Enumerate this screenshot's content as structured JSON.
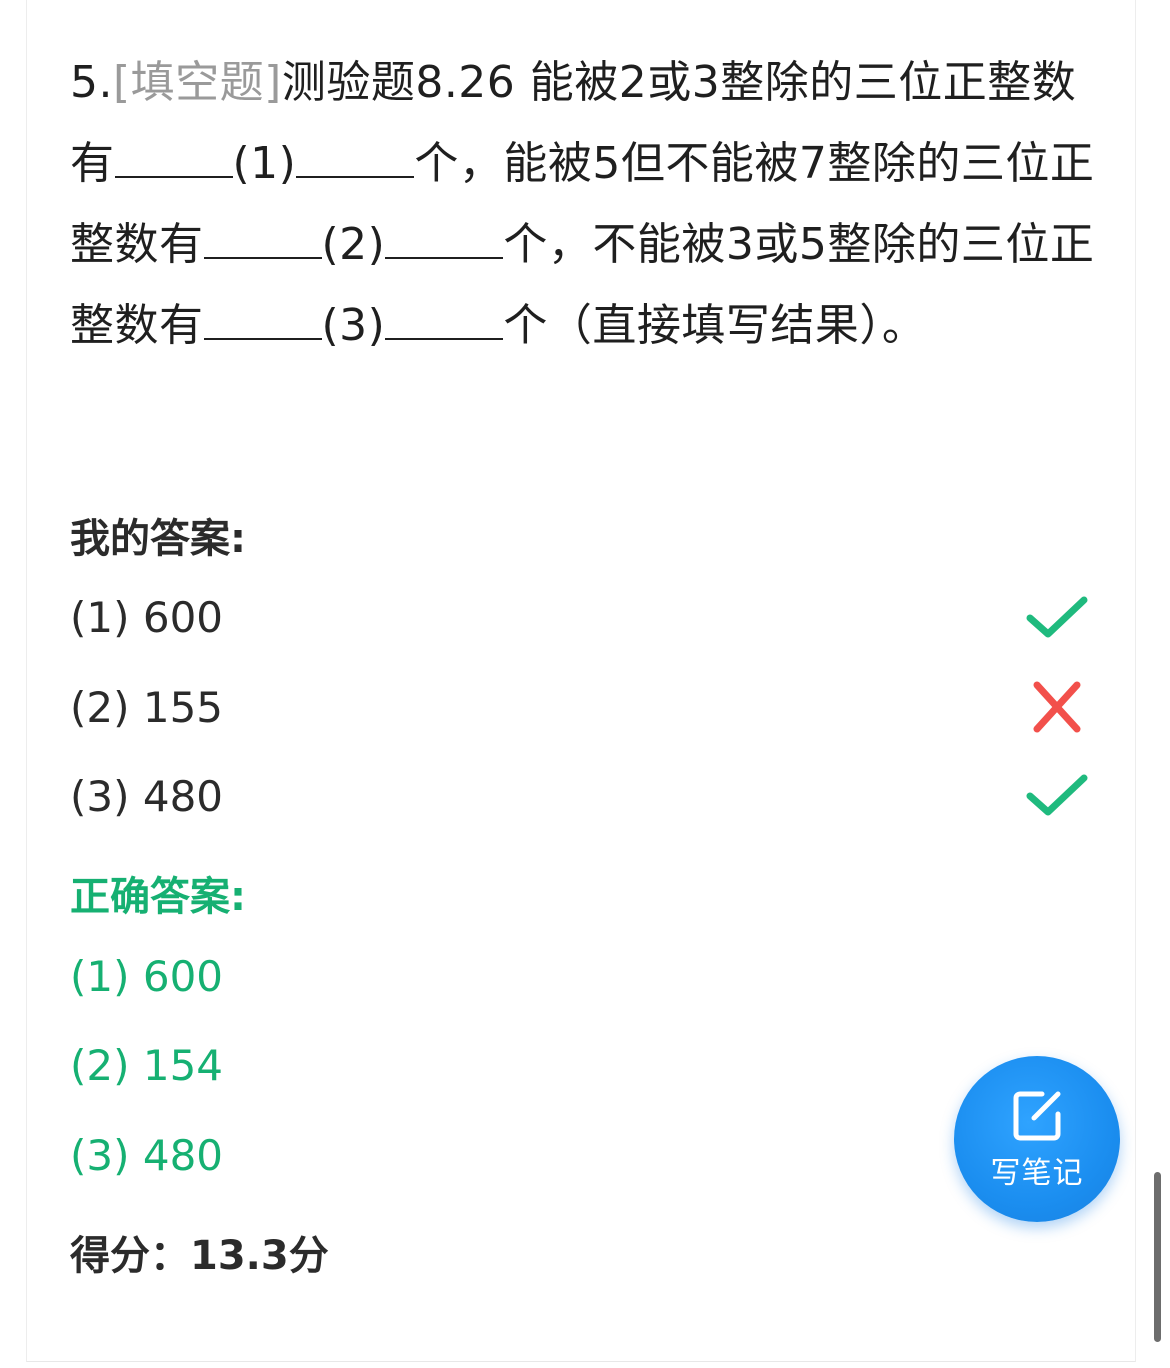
{
  "question": {
    "number": "5.",
    "type_tag": "[填空题]",
    "text_part1": "测验题8.26 能被2或3整除的三位正整数有",
    "blank1_label": "(1)",
    "text_part2": "个，能被5但不能被7整除的三位正整数有",
    "blank2_label": "(2)",
    "text_part3": "个，不能被3或5整除的三位正整数有",
    "blank3_label": "(3)",
    "text_part4": "个（直接填写结果）。"
  },
  "my_answer": {
    "title": "我的答案:",
    "items": [
      {
        "text": "(1) 600",
        "status": "correct"
      },
      {
        "text": "(2) 155",
        "status": "wrong"
      },
      {
        "text": "(3) 480",
        "status": "correct"
      }
    ]
  },
  "correct_answer": {
    "title": "正确答案:",
    "items": [
      "(1) 600",
      "(2) 154",
      "(3) 480"
    ]
  },
  "score": {
    "text": "得分：13.3分"
  },
  "note_button": {
    "label": "写笔记",
    "icon": "edit-note-icon"
  },
  "colors": {
    "correct_green": "#16b072",
    "check_green": "#1fba7e",
    "cross_red": "#f2504b",
    "tag_gray": "#9a9a9a",
    "button_blue": "#1b8ef0"
  }
}
